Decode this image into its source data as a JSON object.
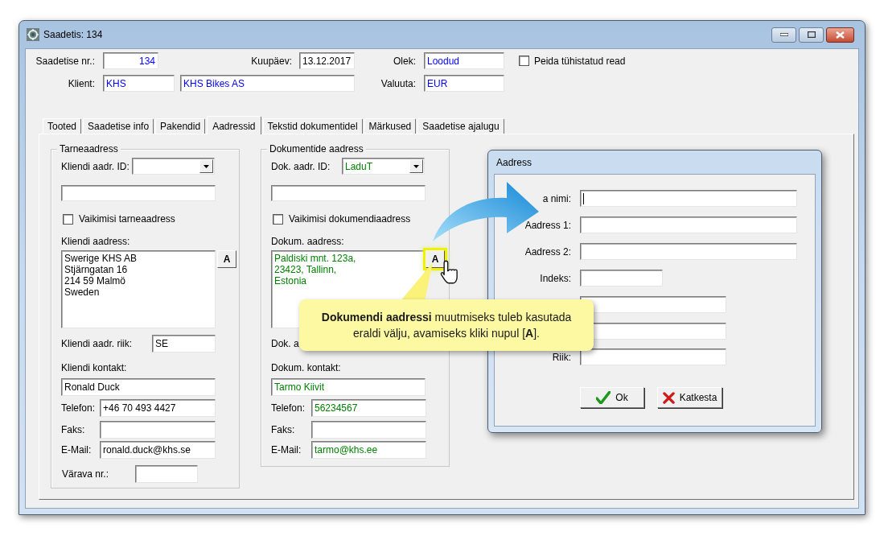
{
  "window": {
    "title": "Saadetis: 134",
    "controls": [
      {
        "kind": "minimize"
      },
      {
        "kind": "maximize"
      },
      {
        "kind": "close"
      }
    ]
  },
  "header": {
    "number": {
      "label": "Saadetise nr.:",
      "value": "134"
    },
    "date": {
      "label": "Kuupäev:",
      "value": "13.12.2017"
    },
    "status": {
      "label": "Olek:",
      "value": "Loodud"
    },
    "client": {
      "label": "Klient:",
      "code": "KHS",
      "name": "KHS Bikes AS"
    },
    "currency": {
      "label": "Valuuta:",
      "value": "EUR"
    },
    "hide_cancelled": {
      "label": "Peida tühistatud read",
      "checked": false
    }
  },
  "tabs": [
    {
      "label": "Tooted",
      "selected": false
    },
    {
      "label": "Saadetise info",
      "selected": false
    },
    {
      "label": "Pakendid",
      "selected": false
    },
    {
      "label": "Aadressid",
      "selected": true
    },
    {
      "label": "Tekstid dokumentidel",
      "selected": false
    },
    {
      "label": "Märkused",
      "selected": false
    },
    {
      "label": "Saadetise ajalugu",
      "selected": false
    }
  ],
  "address_groups": [
    {
      "title": "Tarneaadress",
      "id": {
        "label": "Kliendi aadr. ID:"
      },
      "default": {
        "label": "Vaikimisi tarneaadress",
        "checked": false
      },
      "address": {
        "label": "Kliendi aadress:",
        "lines": [
          "Swerige KHS AB",
          "Stjärngatan 16",
          "214 59 Malmö",
          "Sweden"
        ]
      },
      "edit_button": {
        "label": "A",
        "highlighted": false
      },
      "country": {
        "label": "Kliendi aadr. riik:",
        "value": "SE"
      },
      "contact": {
        "label": "Kliendi kontakt:",
        "name": "Ronald Duck"
      },
      "phone": {
        "label": "Telefon:",
        "value": "+46 70 493 4427"
      },
      "fax": {
        "label": "Faks:"
      },
      "email": {
        "label": "E-Mail:",
        "value": "ronald.duck@khs.se"
      },
      "gate": {
        "label": "Värava nr.:"
      }
    },
    {
      "title": "Dokumentide aadress",
      "id": {
        "label": "Dok. aadr. ID:",
        "value": "LaduT"
      },
      "default": {
        "label": "Vaikimisi dokumendiaadress",
        "checked": false
      },
      "address": {
        "label": "Dokum. aadress:",
        "lines": [
          "Paldiski mnt. 123a,",
          "23423, Tallinn,",
          "Estonia"
        ]
      },
      "edit_button": {
        "label": "A",
        "highlighted": true
      },
      "country": {
        "label": "Dok. a"
      },
      "contact": {
        "label": "Dokum. kontakt:",
        "name": "Tarmo Kiivit"
      },
      "phone": {
        "label": "Telefon:",
        "value": "56234567"
      },
      "fax": {
        "label": "Faks:"
      },
      "email": {
        "label": "E-Mail:",
        "value": "tarmo@khs.ee"
      }
    }
  ],
  "dialog": {
    "title": "Aadress",
    "fields": [
      {
        "label": "a nimi:",
        "kind": "long",
        "focused": true
      },
      {
        "label": "Aadress 1:",
        "kind": "long",
        "focused": false
      },
      {
        "label": "Aadress 2:",
        "kind": "long",
        "focused": false
      },
      {
        "label": "Indeks:",
        "kind": "short",
        "focused": false
      },
      {
        "kind": "medium"
      },
      {
        "kind": "medium"
      },
      {
        "label": "Riik:",
        "kind": "medium",
        "focused": false
      }
    ],
    "buttons": [
      {
        "label": "Ok",
        "kind": "ok"
      },
      {
        "label": "Katkesta",
        "kind": "cancel"
      }
    ]
  },
  "callout": {
    "text": "**Dokumendi aadressi** muutmiseks tuleb kasutada eraldi välju, avamiseks kliki nupul [**A**]."
  }
}
